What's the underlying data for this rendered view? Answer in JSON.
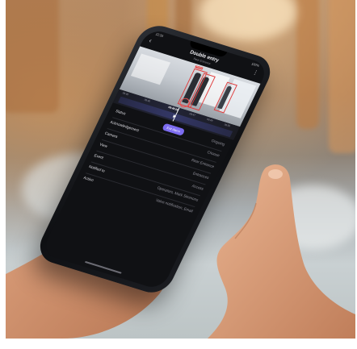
{
  "phone": {
    "status_time": "12:33",
    "status_battery": "100%",
    "title": "Double entry",
    "subtitle": "Rear Entrance",
    "video": {
      "box_tag": "Person"
    },
    "timeline": {
      "labels": [
        "08:45",
        "08:46",
        "08:47",
        "08:49",
        "08:50"
      ],
      "current_time": "08:48:08"
    },
    "details": [
      {
        "label": "Status",
        "value": "Ongoing",
        "button": "Exit Alarm"
      },
      {
        "label": "Acknowledgement",
        "value": "Choose"
      },
      {
        "label": "Camera",
        "value": "Rear Entrance"
      },
      {
        "label": "View",
        "value": "Entrances"
      },
      {
        "label": "Event",
        "value": "Access"
      },
      {
        "label": "Notified to",
        "value": "Operators, Mark Simmons"
      },
      {
        "label": "Action",
        "value": "Valve notification, Email"
      }
    ]
  },
  "colors": {
    "accent_button": "#7c6cf0",
    "detection_box": "#e03b3b"
  },
  "icons": {
    "back": "back-arrow-icon",
    "more": "more-icon",
    "play": "play-icon"
  }
}
